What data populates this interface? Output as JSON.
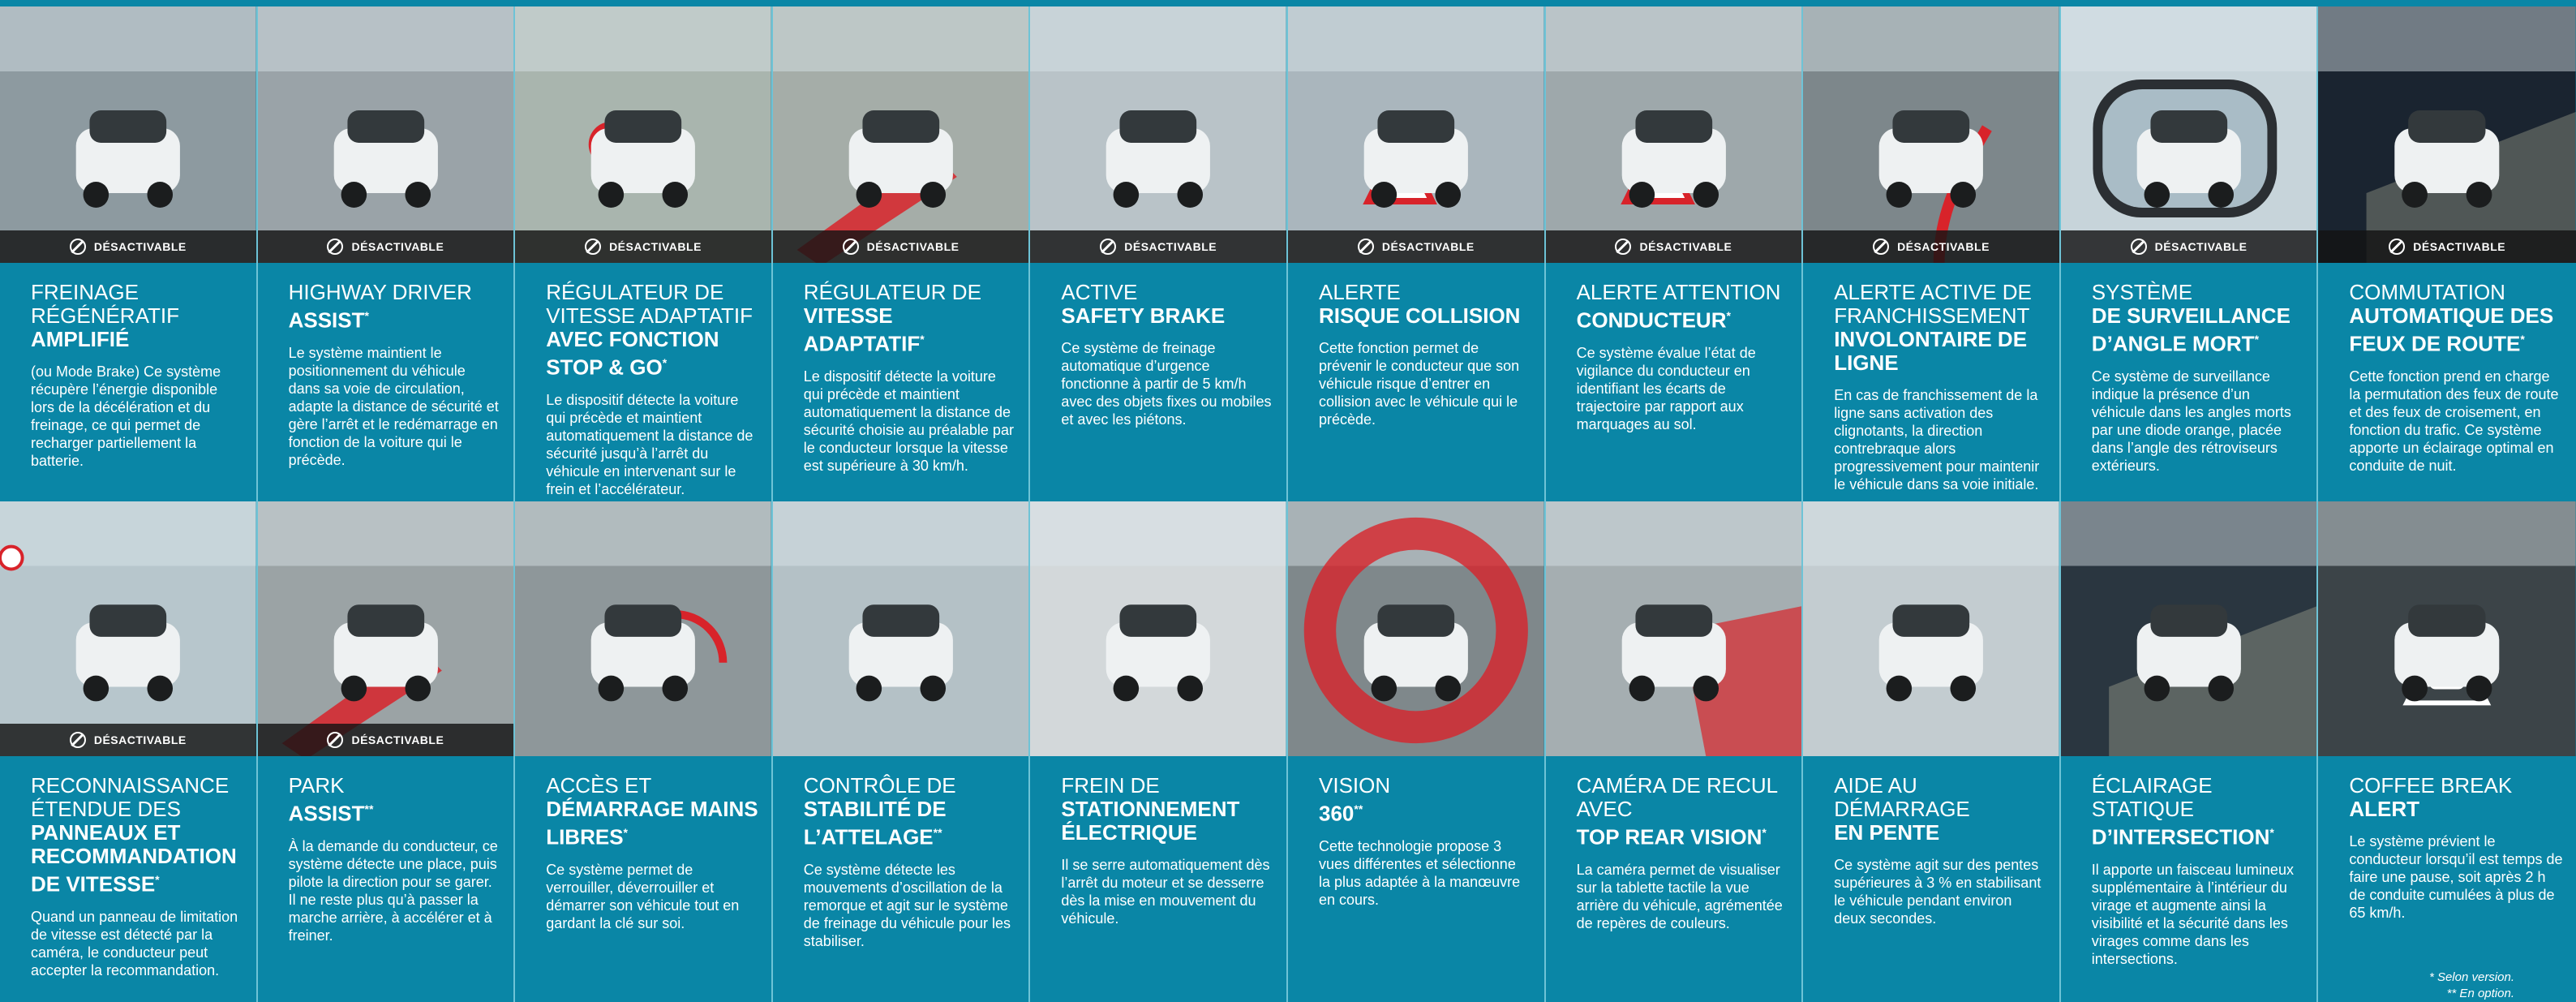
{
  "badge_label": "DÉSACTIVABLE",
  "cards": [
    {
      "title_light": "FREINAGE RÉGÉNÉRATIF",
      "title_bold": "AMPLIFIÉ",
      "sup": "",
      "desc": "(ou Mode Brake) Ce système récupère l’énergie disponible lors de la décélération et du freinage, ce qui permet de recharger partiellement la batterie.",
      "badge": true,
      "scene": "road-top"
    },
    {
      "title_light": "HIGHWAY DRIVER",
      "title_bold": "ASSIST",
      "sup": "*",
      "desc": "Le système maintient le positionnement du véhicule dans sa voie de circulation, adapte la distance de sécurité et gère l’arrêt et le redémarrage en fonction de la voiture qui le précède.",
      "badge": true,
      "scene": "highway"
    },
    {
      "title_light": "RÉGULATEUR DE VITESSE ADAPTATIF",
      "title_bold": "AVEC FONCTION STOP & GO",
      "sup": "*",
      "desc": "Le dispositif détecte la voiture qui précède et maintient automatiquement la distance de sécurité jusqu’à l’arrêt du véhicule en intervenant sur le frein et l’accélérateur.",
      "badge": true,
      "scene": "stopgo"
    },
    {
      "title_light": "RÉGULATEUR DE",
      "title_bold": "VITESSE ADAPTATIF",
      "sup": "*",
      "desc": "Le dispositif détecte la voiture qui précède et maintient automatiquement la distance de sécurité choisie au préalable par le conducteur lorsque la vitesse est supérieure à 30 km/h.",
      "badge": true,
      "scene": "auto"
    },
    {
      "title_light": "ACTIVE",
      "title_bold": "SAFETY BRAKE",
      "sup": "",
      "desc": "Ce système de freinage automatique d’urgence fonctionne à partir de 5 km/h avec des objets fixes ou mobiles et avec les piétons.",
      "badge": true,
      "scene": "brake"
    },
    {
      "title_light": "ALERTE",
      "title_bold": "RISQUE COLLISION",
      "sup": "",
      "desc": "Cette fonction permet de prévenir le conducteur que son véhicule risque d’entrer en collision avec le véhicule qui le précède.",
      "badge": true,
      "scene": "collision"
    },
    {
      "title_light": "ALERTE ATTENTION",
      "title_bold": "CONDUCTEUR",
      "sup": "*",
      "desc": "Ce système évalue l’état de vigilance du conducteur en identifiant les écarts de trajectoire par rapport aux marquages au sol.",
      "badge": true,
      "scene": "attention"
    },
    {
      "title_light": "ALERTE ACTIVE DE FRANCHISSEMENT",
      "title_bold": "INVOLONTAIRE DE LIGNE",
      "sup": "",
      "desc": "En cas de franchissement de la ligne sans activation des clignotants, la direction contrebraque alors progressivement pour maintenir le véhicule dans sa voie initiale.",
      "badge": true,
      "scene": "lane"
    },
    {
      "title_light": "SYSTÈME",
      "title_bold": "DE SURVEILLANCE D’ANGLE MORT",
      "sup": "*",
      "desc": "Ce système de surveillance indique la présence d’un véhicule dans les angles morts par une diode orange, placée dans l’angle des rétroviseurs extérieurs.",
      "badge": true,
      "scene": "mirror"
    },
    {
      "title_light": "COMMUTATION",
      "title_bold": "AUTOMATIQUE DES FEUX DE ROUTE",
      "sup": "*",
      "desc": "Cette fonction prend en charge la permutation des feux de route et des feux de croisement, en fonction du trafic. Ce système apporte un éclairage optimal en conduite de nuit.",
      "badge": true,
      "scene": "night"
    },
    {
      "title_light": "RECONNAISSANCE ÉTENDUE DES",
      "title_bold": "PANNEAUX ET RECOMMANDATION DE VITESSE",
      "sup": "*",
      "desc": "Quand un panneau de limitation de vitesse est détecté par la caméra, le conducteur peut accepter la recommandation.",
      "badge": true,
      "scene": "signs"
    },
    {
      "title_light": "PARK",
      "title_bold": "ASSIST",
      "sup": "**",
      "desc": "À la demande du conducteur, ce système détecte une place, puis pilote la direction pour se garer. Il ne reste plus qu’à passer la marche arrière, à accélérer et à freiner.",
      "badge": true,
      "scene": "park"
    },
    {
      "title_light": "ACCÈS ET",
      "title_bold": "DÉMARRAGE MAINS LIBRES",
      "sup": "*",
      "desc": "Ce système permet de verrouiller, déverrouiller et démarrer son véhicule tout en gardant la clé sur soi.",
      "badge": false,
      "scene": "keyless"
    },
    {
      "title_light": "CONTRÔLE DE",
      "title_bold": "STABILITÉ DE L’ATTELAGE",
      "sup": "**",
      "desc": "Ce système détecte les mouvements d’oscillation de la remorque et agit sur le système de freinage du véhicule pour les stabiliser.",
      "badge": false,
      "scene": "trailer"
    },
    {
      "title_light": "FREIN DE",
      "title_bold": "STATIONNEMENT ÉLECTRIQUE",
      "sup": "",
      "desc": "Il se serre automatiquement dès l’arrêt du moteur et se desserre dès la mise en mouvement du véhicule.",
      "badge": false,
      "scene": "parking-brake"
    },
    {
      "title_light": "VISION",
      "title_bold": "360",
      "sup": "**",
      "desc": "Cette technologie propose 3 vues différentes et sélectionne la plus adaptée à la manœuvre en cours.",
      "badge": false,
      "scene": "vision360"
    },
    {
      "title_light": "CAMÉRA DE RECUL AVEC",
      "title_bold": "TOP REAR VISION",
      "sup": "*",
      "desc": "La caméra permet de visualiser sur la tablette tactile la vue arrière du véhicule, agrémentée de repères de couleurs.",
      "badge": false,
      "scene": "rearcam"
    },
    {
      "title_light": "AIDE AU DÉMARRAGE",
      "title_bold": "EN PENTE",
      "sup": "",
      "desc": "Ce système agit sur des pentes supérieures à 3 % en stabilisant le véhicule pendant environ deux secondes.",
      "badge": false,
      "scene": "hill"
    },
    {
      "title_light": "ÉCLAIRAGE STATIQUE",
      "title_bold": "D’INTERSECTION",
      "sup": "*",
      "desc": "Il apporte un faisceau lumineux supplémentaire à l’intérieur du virage et augmente ainsi la visibilité et la sécurité dans les virages comme dans les intersections.",
      "badge": false,
      "scene": "cornering"
    },
    {
      "title_light": "COFFEE BREAK",
      "title_bold": "ALERT",
      "sup": "",
      "desc": "Le système prévient le conducteur lorsqu’il est temps de faire une pause, soit après 2 h de conduite cumulées à plus de 65 km/h.",
      "badge": false,
      "scene": "coffee"
    }
  ],
  "footnotes": {
    "line1": "* Selon version.",
    "line2": "** En option."
  },
  "colors": {
    "background": "#0a86a6",
    "accent": "#d8232a",
    "divider": "#6ec3d6"
  }
}
